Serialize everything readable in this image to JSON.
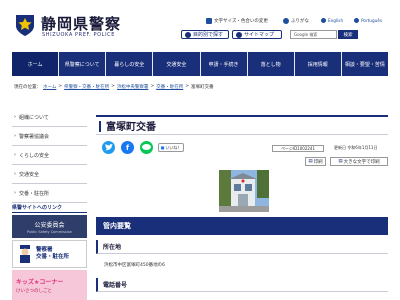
{
  "header": {
    "title": "静岡県警察",
    "subtitle": "SHIZUOKA PREF. POLICE",
    "utility": {
      "text_size": "文字サイズ・色合いの変更",
      "furigana": "ふりがな",
      "english": "English",
      "portuguese": "Português"
    },
    "buttons": {
      "purpose": "目的別で探す",
      "sitemap": "サイトマップ"
    },
    "search": {
      "placeholder": "Google 検索",
      "button": "検索"
    }
  },
  "nav": {
    "items": [
      {
        "label": "ホーム"
      },
      {
        "label": "県警察について"
      },
      {
        "label": "暮らしの安全"
      },
      {
        "label": "交通安全"
      },
      {
        "label": "申請・手続き"
      },
      {
        "label": "落とし物"
      },
      {
        "label": "採用情報"
      },
      {
        "label": "相談・要望・苦情"
      }
    ]
  },
  "breadcrumb": {
    "prefix": "現在の位置：",
    "items": [
      "ホーム",
      "県警察・交番・駐在所",
      "浜松中央警察署",
      "交番・駐在所"
    ],
    "current": "富塚町交番"
  },
  "sidebar": {
    "items": [
      {
        "label": "組織について"
      },
      {
        "label": "警察署協議会"
      },
      {
        "label": "くらしの安全"
      },
      {
        "label": "交通安全"
      },
      {
        "label": "交番・駐在所"
      }
    ],
    "links_heading": "県警サイトへのリンク",
    "banner1": {
      "title": "公安委員会",
      "sub": "Public Safety Commission"
    },
    "banner2": {
      "line1": "警察署",
      "line2": "交番・駐在所"
    },
    "banner3": {
      "title": "キッズ★コーナー",
      "sub": "けいさつのしごと"
    }
  },
  "main": {
    "title": "富塚町交番",
    "like": "いいね！",
    "page_id": "ページID1002241",
    "updated": "更新日 令和6年1月11日",
    "print": "印刷",
    "big_print": "大きな文字で印刷",
    "section_heading": "管内要覧",
    "location_heading": "所在地",
    "address": "浜松市中区富塚町450番地の6",
    "phone_heading": "電話番号"
  },
  "colors": {
    "navy": "#1a2f7a",
    "twitter": "#1d9bf0",
    "facebook": "#1877f2",
    "line": "#06c755"
  }
}
